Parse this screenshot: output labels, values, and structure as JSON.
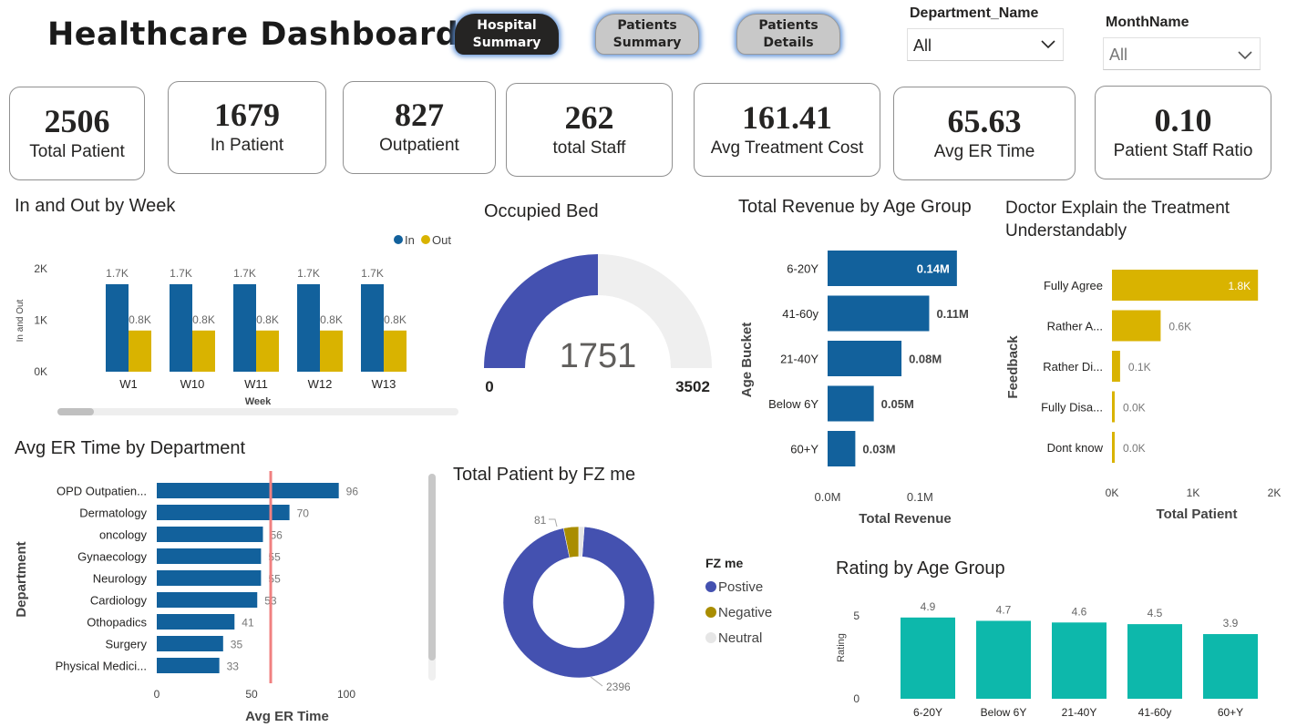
{
  "header": {
    "title": "Healthcare  Dashboard",
    "nav": [
      "Hospital Summary",
      "Patients Summary",
      "Patients Details"
    ],
    "nav_active": 0
  },
  "slicers": [
    {
      "label": "Department_Name",
      "value": "All"
    },
    {
      "label": "MonthName",
      "value": "All"
    }
  ],
  "kpis": [
    {
      "value": "2506",
      "label": "Total Patient"
    },
    {
      "value": "1679",
      "label": "In Patient"
    },
    {
      "value": "827",
      "label": "Outpatient"
    },
    {
      "value": "262",
      "label": "total Staff"
    },
    {
      "value": "161.41",
      "label": "Avg Treatment Cost"
    },
    {
      "value": "65.63",
      "label": "Avg ER Time"
    },
    {
      "value": "0.10",
      "label": "Patient Staff Ratio"
    }
  ],
  "titles": {
    "inout": "In and Out by Week",
    "bed": "Occupied Bed",
    "revenue": "Total Revenue by Age Group",
    "doctor": "Doctor Explain the Treatment Understandably",
    "er": "Avg ER Time by Department",
    "fz": "Total Patient by FZ me",
    "rating": "Rating by Age Group"
  },
  "colors": {
    "blue": "#12619c",
    "gold": "#d9b300",
    "indigo": "#4451b0",
    "olive": "#a98d00",
    "gray": "#e6e6e6",
    "teal": "#0db8ab",
    "red": "#f08080"
  },
  "chart_data": [
    {
      "id": "inout",
      "type": "bar",
      "title": "In and Out by Week",
      "xlabel": "Week",
      "ylabel": "In and Out",
      "categories": [
        "W1",
        "W10",
        "W11",
        "W12",
        "W13"
      ],
      "series": [
        {
          "name": "In",
          "values": [
            1700,
            1700,
            1700,
            1700,
            1700
          ],
          "labels": [
            "1.7K",
            "1.7K",
            "1.7K",
            "1.7K",
            "1.7K"
          ]
        },
        {
          "name": "Out",
          "values": [
            800,
            800,
            800,
            800,
            800
          ],
          "labels": [
            "0.8K",
            "0.8K",
            "0.8K",
            "0.8K",
            "0.8K"
          ]
        }
      ],
      "yticks": [
        "0K",
        "1K",
        "2K"
      ],
      "ylim": [
        0,
        2000
      ],
      "legend": "top-right"
    },
    {
      "id": "bed",
      "type": "gauge",
      "title": "Occupied Bed",
      "value": 1751,
      "value_label": "1751",
      "min": 0,
      "max": 3502,
      "min_label": "0",
      "max_label": "3502"
    },
    {
      "id": "revenue",
      "type": "bar",
      "orientation": "horizontal",
      "title": "Total Revenue by Age Group",
      "xlabel": "Total Revenue",
      "ylabel": "Age Bucket",
      "categories": [
        "6-20Y",
        "41-60y",
        "21-40Y",
        "Below 6Y",
        "60+Y"
      ],
      "values": [
        0.14,
        0.11,
        0.08,
        0.05,
        0.03
      ],
      "labels": [
        "0.14M",
        "0.11M",
        "0.08M",
        "0.05M",
        "0.03M"
      ],
      "xticks": [
        "0.0M",
        "0.1M"
      ],
      "xlim": [
        0,
        0.15
      ]
    },
    {
      "id": "doctor",
      "type": "bar",
      "orientation": "horizontal",
      "title": "Doctor Explain the Treatment Understandably",
      "xlabel": "Total Patient",
      "ylabel": "Feedback",
      "categories": [
        "Fully Agree",
        "Rather A...",
        "Rather Di...",
        "Fully Disa...",
        "Dont know"
      ],
      "values": [
        1800,
        600,
        100,
        20,
        10
      ],
      "labels": [
        "1.8K",
        "0.6K",
        "0.1K",
        "0.0K",
        "0.0K"
      ],
      "xticks": [
        "0K",
        "1K",
        "2K"
      ],
      "xlim": [
        0,
        2000
      ]
    },
    {
      "id": "er",
      "type": "bar",
      "orientation": "horizontal",
      "title": "Avg ER Time by Department",
      "xlabel": "Avg ER Time",
      "ylabel": "Department",
      "categories": [
        "OPD Outpatien...",
        "Dermatology",
        "oncology",
        "Gynaecology",
        "Neurology",
        "Cardiology",
        "Othopadics",
        "Surgery",
        "Physical Medici..."
      ],
      "values": [
        96,
        70,
        56,
        55,
        55,
        53,
        41,
        35,
        33
      ],
      "xticks": [
        "0",
        "50",
        "100"
      ],
      "xlim": [
        0,
        100
      ],
      "reference_line": 65.63
    },
    {
      "id": "fz",
      "type": "pie",
      "title": "Total Patient by FZ me",
      "legend_title": "FZ me",
      "categories": [
        "Postive",
        "Negative",
        "Neutral"
      ],
      "values": [
        2396,
        81,
        29
      ],
      "labels": [
        "2396",
        "81",
        ""
      ]
    },
    {
      "id": "rating",
      "type": "bar",
      "title": "Rating by Age Group",
      "ylabel": "Rating",
      "categories": [
        "6-20Y",
        "Below 6Y",
        "21-40Y",
        "41-60y",
        "60+Y"
      ],
      "values": [
        4.9,
        4.7,
        4.6,
        4.5,
        3.9
      ],
      "yticks": [
        "0",
        "5"
      ],
      "ylim": [
        0,
        5
      ]
    }
  ]
}
